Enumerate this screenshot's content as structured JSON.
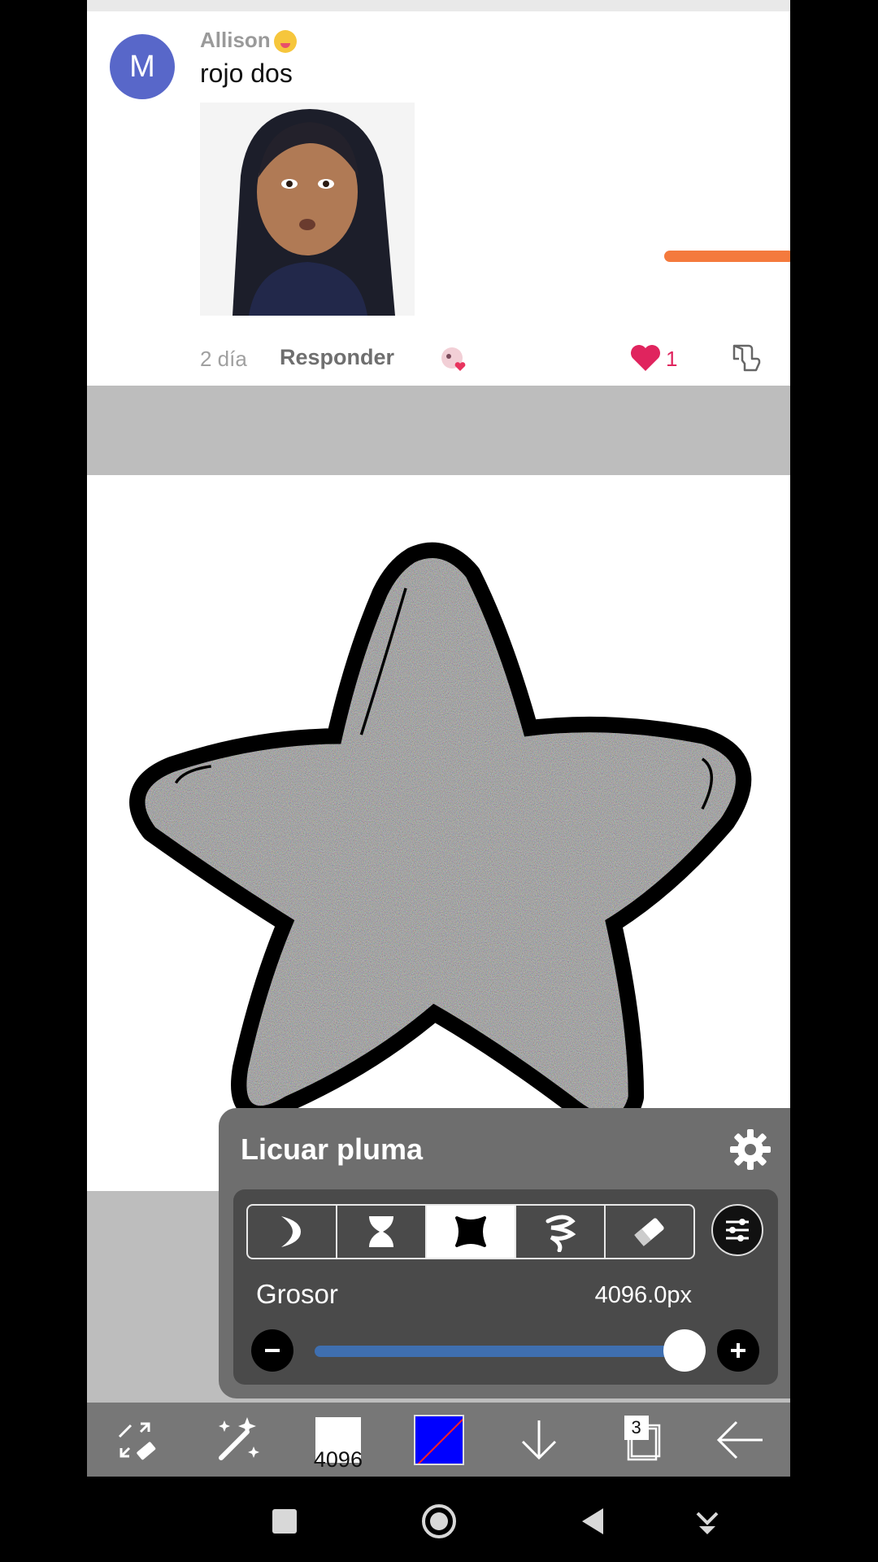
{
  "comment": {
    "avatar_initial": "M",
    "username": "Allison",
    "username_emoji": "squinting-face-with-tongue",
    "text": "rojo dos",
    "time": "2 día",
    "reply_label": "Responder",
    "like_count": "1"
  },
  "panel": {
    "title": "Licuar pluma",
    "brush_modes": [
      "moon-icon",
      "hourglass-icon",
      "blob-icon",
      "swirl-icon",
      "eraser-icon"
    ],
    "active_mode": "blob-icon",
    "thickness_label": "Grosor",
    "thickness_value": "4096.0px",
    "thickness_fraction": 0.98
  },
  "toolbar": {
    "brush_size_label": "4096",
    "layer_count": "3",
    "current_color": "#0000ff"
  },
  "colors": {
    "accent": "#3f6fb0",
    "like": "#e0245e",
    "avatar": "#5867c9",
    "orange": "#f47a3d"
  }
}
